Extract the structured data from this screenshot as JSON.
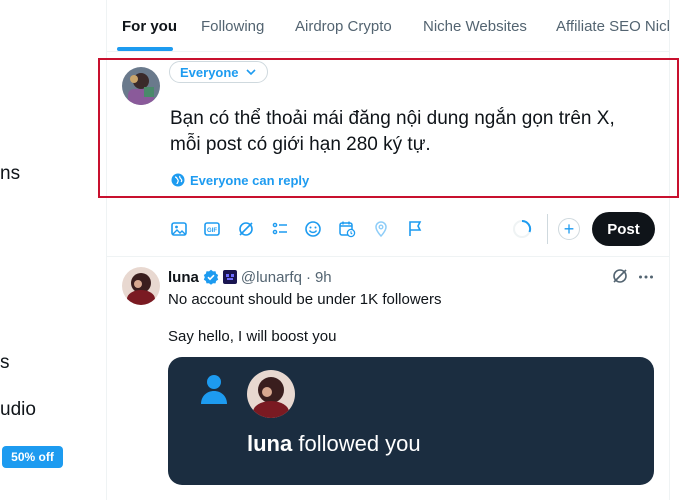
{
  "sidebar_fragments": [
    "ns",
    "s",
    "udio"
  ],
  "promo_badge": "50% off",
  "tabs": [
    {
      "label": "For you",
      "active": true
    },
    {
      "label": "Following",
      "active": false
    },
    {
      "label": "Airdrop Crypto",
      "active": false
    },
    {
      "label": "Niche Websites",
      "active": false
    },
    {
      "label": "Affiliate SEO Nich",
      "active": false
    }
  ],
  "composer": {
    "audience": "Everyone",
    "text_line1": "Bạn có thể thoải mái đăng nội dung ngắn gọn trên X,",
    "text_line2": "mỗi post có giới hạn 280 ký tự.",
    "reply_setting": "Everyone can reply",
    "toolbar_icons": [
      "image-icon",
      "gif-icon",
      "grok-icon",
      "poll-icon",
      "emoji-icon",
      "schedule-icon",
      "location-icon",
      "flag-icon"
    ],
    "post_label": "Post",
    "add_label": "+"
  },
  "tweet": {
    "author": "luna",
    "handle": "@lunarfq",
    "separator": "·",
    "time": "9h",
    "line1": "No account should be under 1K followers",
    "line2": "Say hello, I will boost you",
    "card": {
      "name": "luna",
      "rest": " followed you"
    }
  },
  "colors": {
    "accent": "#1d9bf0",
    "highlight_frame": "#c8102e",
    "card_bg": "#1b2d40",
    "post_button": "#0f1419"
  }
}
